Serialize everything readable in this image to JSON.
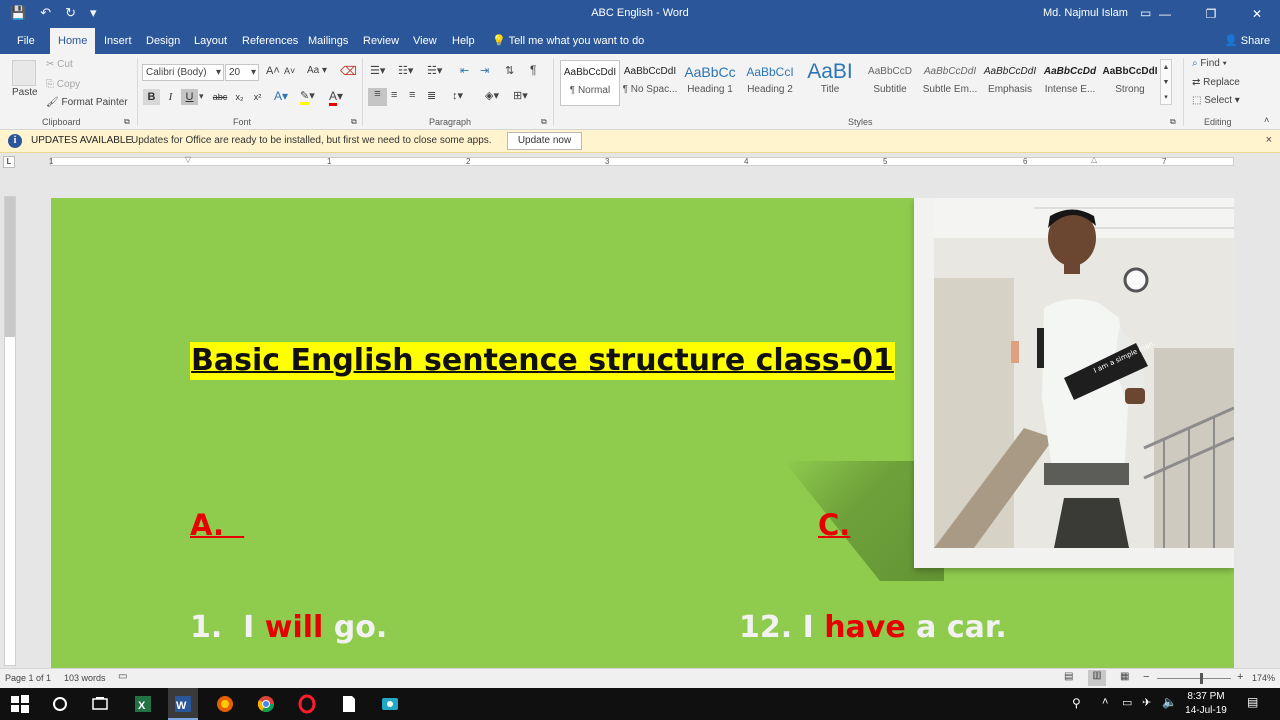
{
  "window": {
    "title": "ABC English  -  Word",
    "user": "Md. Najmul Islam",
    "minimize": "—",
    "restore": "❐",
    "close": "✕"
  },
  "qat": {
    "save": "💾",
    "undo": "↶",
    "redo": "↻",
    "customize": "▾"
  },
  "tabs": [
    "File",
    "Home",
    "Insert",
    "Design",
    "Layout",
    "References",
    "Mailings",
    "Review",
    "View",
    "Help"
  ],
  "active_tab": "Home",
  "tell_me": "Tell me what you want to do",
  "share": "Share",
  "clipboard": {
    "paste": "Paste",
    "cut": "Cut",
    "copy": "Copy",
    "format_painter": "Format Painter",
    "label": "Clipboard"
  },
  "font": {
    "name": "Calibri (Body)",
    "size": "20",
    "grow": "A",
    "shrink": "A",
    "case": "Aa",
    "bold": "B",
    "italic": "I",
    "underline": "U",
    "strike": "abc",
    "sub": "x₂",
    "sup": "x²",
    "label": "Font"
  },
  "paragraph": {
    "label": "Paragraph",
    "pilcrow": "¶"
  },
  "styles": {
    "label": "Styles",
    "items": [
      {
        "preview": "AaBbCcDdI",
        "name": "¶ Normal"
      },
      {
        "preview": "AaBbCcDdI",
        "name": "¶ No Spac..."
      },
      {
        "preview": "AaBbCc",
        "name": "Heading 1"
      },
      {
        "preview": "AaBbCcI",
        "name": "Heading 2"
      },
      {
        "preview": "AaBI",
        "name": "Title"
      },
      {
        "preview": "AaBbCcD",
        "name": "Subtitle"
      },
      {
        "preview": "AaBbCcDdI",
        "name": "Subtle Em..."
      },
      {
        "preview": "AaBbCcDdI",
        "name": "Emphasis"
      },
      {
        "preview": "AaBbCcDd",
        "name": "Intense E..."
      },
      {
        "preview": "AaBbCcDdI",
        "name": "Strong"
      }
    ]
  },
  "editing": {
    "find": "Find",
    "replace": "Replace",
    "select": "Select",
    "label": "Editing"
  },
  "update_bar": {
    "heading": "UPDATES AVAILABLE",
    "message": "Updates for Office are ready to be installed, but first we need to close some apps.",
    "button": "Update now",
    "close": "×"
  },
  "ruler": {
    "numbers": [
      "1",
      "1",
      "2",
      "3",
      "4",
      "5",
      "6",
      "7"
    ]
  },
  "document": {
    "title": "Basic English sentence structure class-01",
    "section_a": "A.  ",
    "section_c": "C.",
    "photo_card_text": "I am a simple man.",
    "sentence1": {
      "num": "1.  I ",
      "highlight": "will",
      "rest": " go."
    },
    "sentence12": {
      "num": "12. I ",
      "highlight": "have",
      "rest": " a car."
    }
  },
  "status": {
    "page": "Page 1 of 1",
    "words": "103 words",
    "zoom": "174%"
  },
  "taskbar": {
    "time": "8:37 PM",
    "date": "14-Jul-19"
  },
  "colors": {
    "word_blue": "#2b579a",
    "doc_bg": "#8fcc4e",
    "highlight_yellow": "#ffff00",
    "accent_red": "#e60000"
  }
}
